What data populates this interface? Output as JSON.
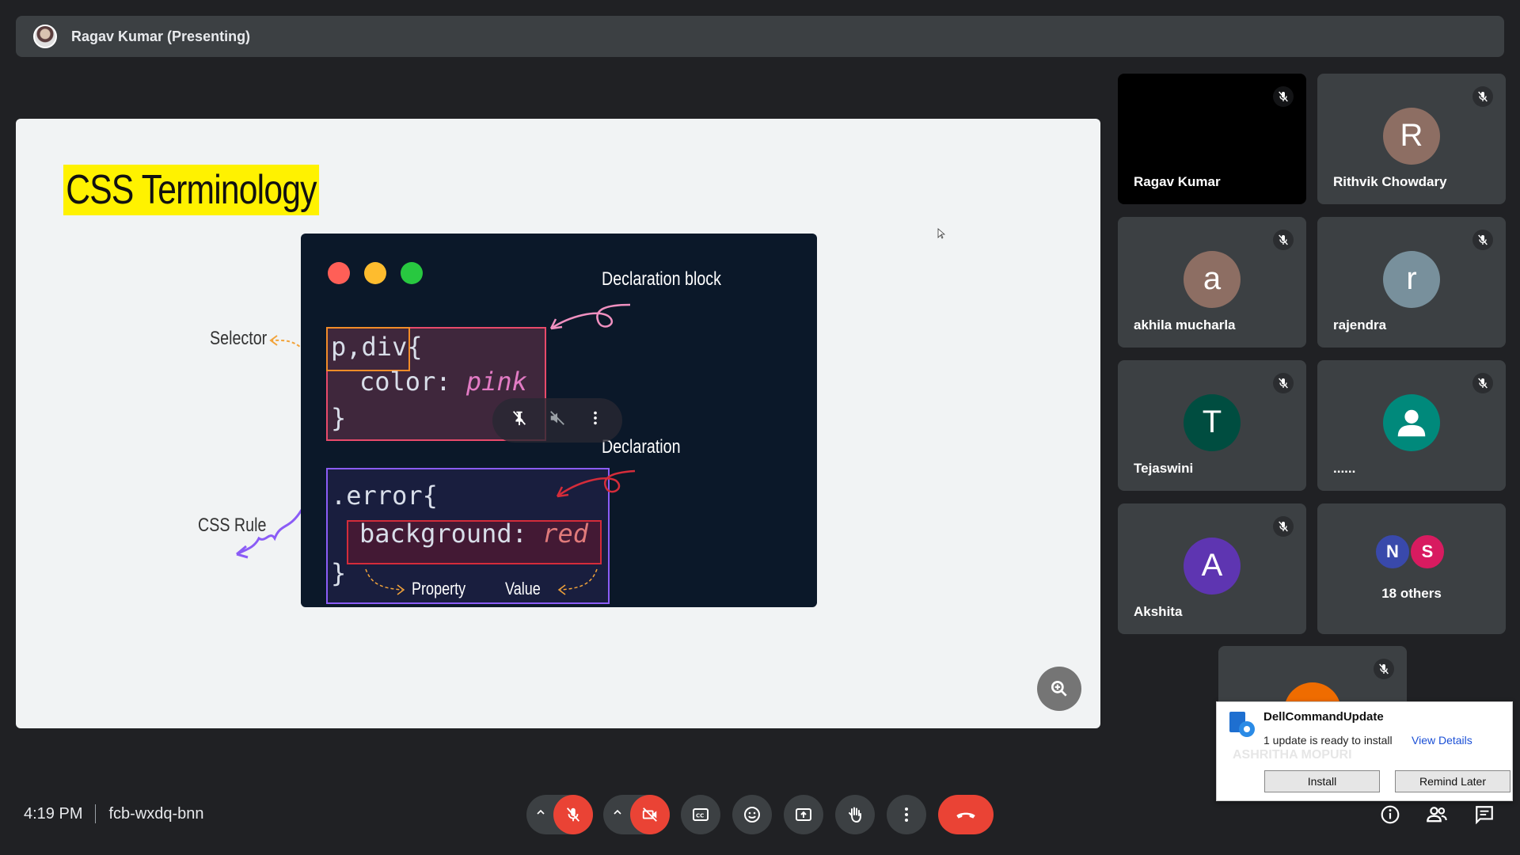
{
  "topbar": {
    "presenter": "Ragav Kumar (Presenting)"
  },
  "slide": {
    "title": "CSS Terminology",
    "code_line1": "p,div{",
    "code_line2_prop": "color: ",
    "code_line2_val": "pink",
    "code_line3": "}",
    "code_line4": ".error{",
    "code_line5_prop": "background: ",
    "code_line5_val": "red",
    "code_line6": "}",
    "label_declaration_block": "Declaration block",
    "label_declaration": "Declaration",
    "label_property": "Property",
    "label_value": "Value",
    "label_selector": "Selector",
    "label_css_rule": "CSS Rule"
  },
  "participants": [
    {
      "name": "Ragav Kumar",
      "initial": "",
      "color": "#000000"
    },
    {
      "name": "Rithvik Chowdary",
      "initial": "R",
      "color": "#8d6e63"
    },
    {
      "name": "akhila mucharla",
      "initial": "a",
      "color": "#8d6e63"
    },
    {
      "name": "rajendra",
      "initial": "r",
      "color": "#78909c"
    },
    {
      "name": "Tejaswini",
      "initial": "T",
      "color": "#004d40"
    },
    {
      "name": "......",
      "initial": "",
      "color": "#00897b"
    },
    {
      "name": "Akshita",
      "initial": "A",
      "color": "#5e35b1"
    },
    {
      "name": "ASHRITHA MOPURI",
      "initial": "",
      "color": "#ef6c00"
    }
  ],
  "others": {
    "label": "18 others",
    "initials": [
      "N",
      "S"
    ],
    "colors": [
      "#3949ab",
      "#d81b60"
    ]
  },
  "meeting": {
    "time": "4:19 PM",
    "code": "fcb-wxdq-bnn"
  },
  "notification": {
    "title": "DellCommandUpdate",
    "message": "1 update is ready to install",
    "link": "View Details",
    "install": "Install",
    "remind": "Remind Later"
  },
  "icons": [
    "mic-off-icon",
    "camera-off-icon",
    "captions-icon",
    "emoji-icon",
    "present-icon",
    "raise-hand-icon",
    "more-icon",
    "end-call-icon",
    "info-icon",
    "people-icon",
    "chat-icon",
    "zoom-icon"
  ]
}
